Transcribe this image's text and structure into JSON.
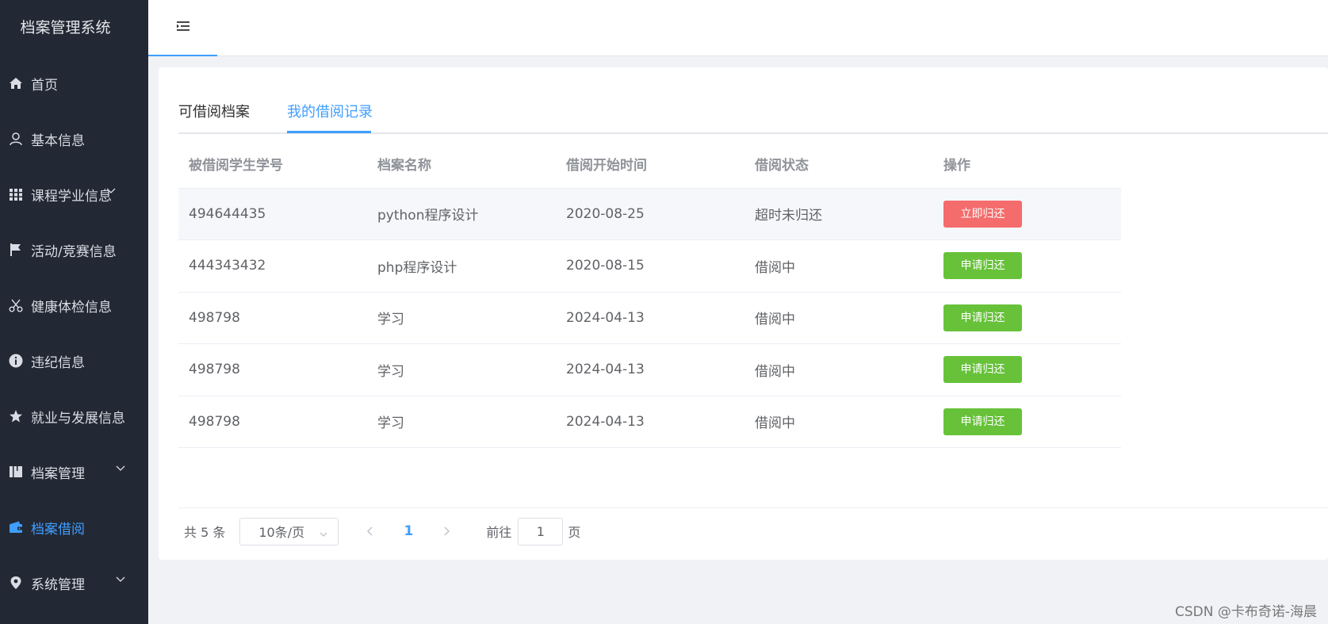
{
  "app": {
    "title": "档案管理系统"
  },
  "sidebar": {
    "items": [
      {
        "label": "首页",
        "icon": "home-icon"
      },
      {
        "label": "基本信息",
        "icon": "user-icon"
      },
      {
        "label": "课程学业信息",
        "icon": "grid-icon",
        "expandable": true
      },
      {
        "label": "活动/竞赛信息",
        "icon": "flag-icon"
      },
      {
        "label": "健康体检信息",
        "icon": "scissors-icon"
      },
      {
        "label": "违纪信息",
        "icon": "info-icon"
      },
      {
        "label": "就业与发展信息",
        "icon": "star-icon"
      },
      {
        "label": "档案管理",
        "icon": "book-icon",
        "expandable": true
      },
      {
        "label": "档案借阅",
        "icon": "wallet-icon",
        "active": true
      },
      {
        "label": "系统管理",
        "icon": "location-icon",
        "expandable": true
      }
    ]
  },
  "tabs": [
    {
      "label": "可借阅档案"
    },
    {
      "label": "我的借阅记录",
      "active": true
    }
  ],
  "table": {
    "headers": [
      "被借阅学生学号",
      "档案名称",
      "借阅开始时间",
      "借阅状态",
      "操作"
    ],
    "rows": [
      {
        "id": "494644435",
        "name": "python程序设计",
        "date": "2020-08-25",
        "status": "超时未归还",
        "action": "立即归还"
      },
      {
        "id": "444343432",
        "name": "php程序设计",
        "date": "2020-08-15",
        "status": "借阅中",
        "action": "申请归还"
      },
      {
        "id": "498798",
        "name": "学习",
        "date": "2024-04-13",
        "status": "借阅中",
        "action": "申请归还"
      },
      {
        "id": "498798",
        "name": "学习",
        "date": "2024-04-13",
        "status": "借阅中",
        "action": "申请归还"
      },
      {
        "id": "498798",
        "name": "学习",
        "date": "2024-04-13",
        "status": "借阅中",
        "action": "申请归还"
      }
    ]
  },
  "pagination": {
    "total_text": "共 5 条",
    "page_size": "10条/页",
    "current_page": "1",
    "goto_label": "前往",
    "goto_value": "1",
    "goto_suffix": "页"
  },
  "watermark": "CSDN @卡布奇诺-海晨",
  "colors": {
    "sidebar_bg": "#222834",
    "accent": "#409eff",
    "danger": "#f56c6c",
    "warning": "#e6a23c",
    "success": "#67c23a"
  }
}
